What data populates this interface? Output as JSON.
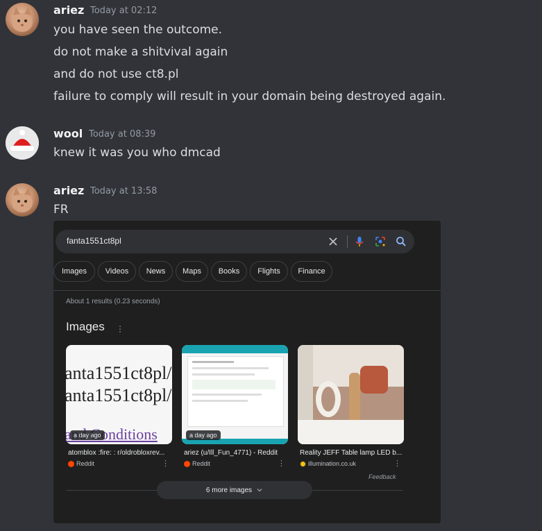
{
  "messages": [
    {
      "username": "ariez",
      "timestamp": "Today at 02:12",
      "avatar": "cat-avatar",
      "lines": [
        "you have seen the outcome.",
        "do not make a shitvival again",
        "and do not use ct8.pl",
        "failure to comply will result in your domain being destroyed again."
      ]
    },
    {
      "username": "wool",
      "timestamp": "Today at 08:39",
      "avatar": "santa-hat-avatar",
      "lines": [
        "knew it was you who dmcad"
      ]
    },
    {
      "username": "ariez",
      "timestamp": "Today at 13:58",
      "avatar": "cat-avatar",
      "lines": [
        "FR"
      ]
    }
  ],
  "embed": {
    "search_query": "fanta1551ct8pl",
    "chips": [
      "Images",
      "Videos",
      "News",
      "Maps",
      "Books",
      "Flights",
      "Finance"
    ],
    "about": "About 1 results (0.23 seconds)",
    "images_heading": "Images",
    "results": [
      {
        "caption": "atomblox :fire: : r/oldrobloxrev...",
        "source": "Reddit",
        "age": "a day ago",
        "thumb_text_1": "anta1551ct8pl/",
        "thumb_text_2": "anta1551ct8pl/",
        "thumb_text_3": "and Conditions"
      },
      {
        "caption": "ariez (u/Ill_Fun_4771) - Reddit",
        "source": "Reddit",
        "age": "a day ago"
      },
      {
        "caption": "Reality JEFF Table lamp LED b...",
        "source": "illumination.co.uk"
      }
    ],
    "feedback": "Feedback",
    "more_images": "6 more images",
    "colors": {
      "reddit": "#ff4500",
      "illumination": "#f4c20d",
      "mic": "#4285f4"
    }
  }
}
